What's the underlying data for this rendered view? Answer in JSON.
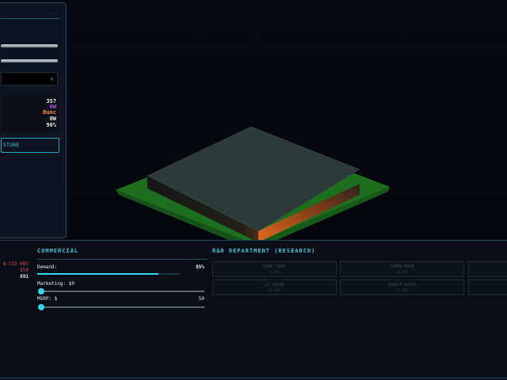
{
  "design_panel": {
    "stats": [
      "357",
      "0W",
      "Bunc",
      "0W",
      "96%"
    ],
    "action_label": "STURE"
  },
  "finance": {
    "row1": "$-115 685",
    "row2": "$50",
    "row3": "691"
  },
  "commercial": {
    "title": "COMMERCIAL",
    "demand_label": "Demand:",
    "demand_value": "85%",
    "demand_fraction": 0.85,
    "marketing_label": "Marketing: $0",
    "marketing_fraction": 0,
    "msrp_label": "MSRP: $",
    "msrp_max": "50",
    "msrp_fraction": 0
  },
  "rnd": {
    "title": "R&D DEPARTMENT (RESEARCH)",
    "cards": [
      {
        "title": "DUAL CORE",
        "cost": "$5,000"
      },
      {
        "title": "TURBO MODE",
        "cost": "$8,000"
      },
      {
        "title": "",
        "cost": ""
      },
      {
        "title": "L3 CACHE",
        "cost": "$3,000"
      },
      {
        "title": "HIGH-K GATES",
        "cost": "$5,000"
      },
      {
        "title": "",
        "cost": ""
      }
    ]
  },
  "colors": {
    "accent": "#35d4ec",
    "pcb": "#1d6f1e",
    "chip_top": "#2c3b3a",
    "glow": "#d4601a",
    "negative": "#e04a4a"
  }
}
